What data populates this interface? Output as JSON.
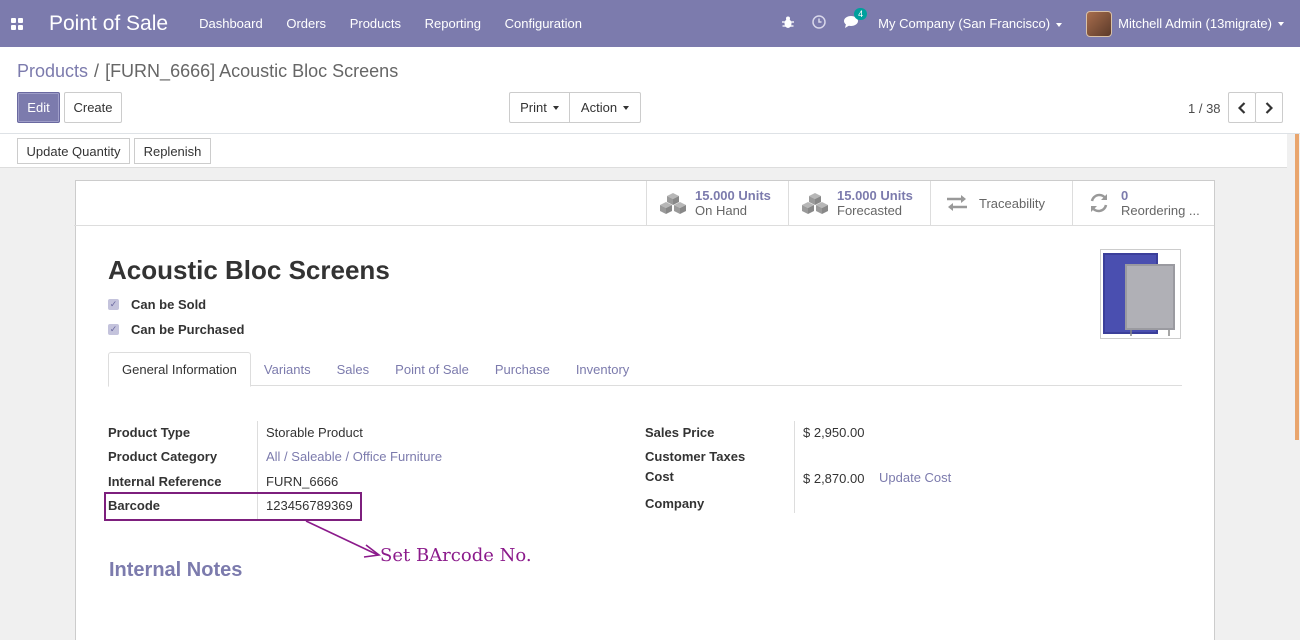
{
  "navbar": {
    "brand": "Point of Sale",
    "menu": [
      "Dashboard",
      "Orders",
      "Products",
      "Reporting",
      "Configuration"
    ],
    "messages_badge": "4",
    "company": "My Company (San Francisco)",
    "user": "Mitchell Admin (13migrate)"
  },
  "breadcrumb": {
    "parent": "Products",
    "separator": "/",
    "current": "[FURN_6666] Acoustic Bloc Screens"
  },
  "buttons": {
    "edit": "Edit",
    "create": "Create",
    "print": "Print",
    "action": "Action"
  },
  "pager": {
    "value": "1 / 38"
  },
  "statusbar": {
    "update_qty": "Update Quantity",
    "replenish": "Replenish"
  },
  "smart_buttons": [
    {
      "value": "15.000 Units",
      "label": "On Hand",
      "icon": "cubes-icon"
    },
    {
      "value": "15.000 Units",
      "label": "Forecasted",
      "icon": "cubes-icon"
    },
    {
      "value": "",
      "label": "Traceability",
      "icon": "exchange-icon"
    },
    {
      "value": "0",
      "label": "Reordering ...",
      "icon": "refresh-icon"
    }
  ],
  "product": {
    "name": "Acoustic Bloc Screens",
    "can_be_sold": "Can be Sold",
    "can_be_purchased": "Can be Purchased"
  },
  "tabs": [
    "General Information",
    "Variants",
    "Sales",
    "Point of Sale",
    "Purchase",
    "Inventory"
  ],
  "fields_left": [
    {
      "label": "Product Type",
      "value": "Storable Product"
    },
    {
      "label": "Product Category",
      "value": "All / Saleable / Office Furniture"
    },
    {
      "label": "Internal Reference",
      "value": "FURN_6666"
    },
    {
      "label": "Barcode",
      "value": "123456789369"
    }
  ],
  "fields_right": [
    {
      "label": "Sales Price",
      "value": "$ 2,950.00"
    },
    {
      "label": "Customer Taxes",
      "value": ""
    },
    {
      "label": "Cost",
      "value": "$ 2,870.00"
    },
    {
      "label": "Company",
      "value": ""
    }
  ],
  "update_cost": "Update Cost",
  "annotation": "Set BArcode No.",
  "internal_notes": "Internal Notes"
}
